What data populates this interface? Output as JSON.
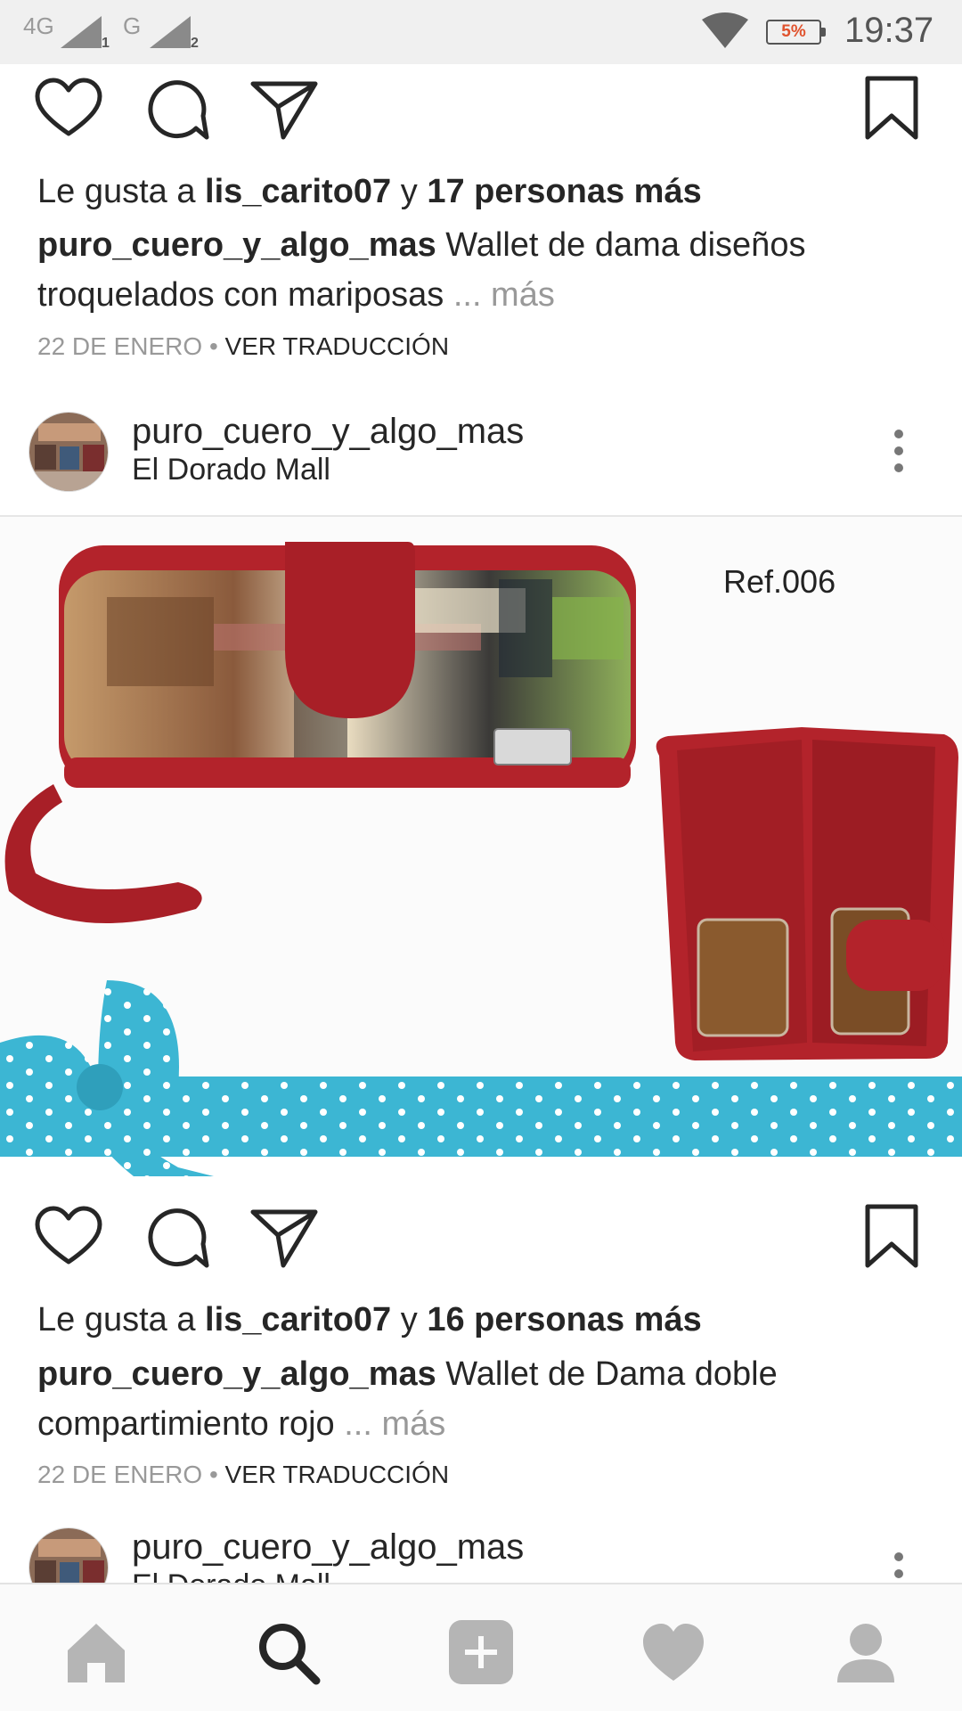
{
  "status_bar": {
    "signal1_label": "4G",
    "signal1_sub": "1",
    "signal2_label": "G",
    "signal2_sub": "2",
    "battery": "5%",
    "time": "19:37"
  },
  "post1_footer": {
    "likes_prefix": "Le gusta a ",
    "likes_user": "lis_carito07",
    "likes_mid": " y ",
    "likes_count": "17 personas más",
    "caption_user": "puro_cuero_y_algo_mas",
    "caption_text": " Wallet de dama diseños troquelados con mariposas ",
    "caption_more": "... más",
    "date": "22 DE ENERO",
    "separator": " • ",
    "translate": "VER TRADUCCIÓN"
  },
  "post2": {
    "username": "puro_cuero_y_algo_mas",
    "location": "El Dorado Mall",
    "image_ref": "Ref.006",
    "likes_prefix": "Le gusta a ",
    "likes_user": "lis_carito07",
    "likes_mid": " y ",
    "likes_count": "16 personas más",
    "caption_user": "puro_cuero_y_algo_mas",
    "caption_text": " Wallet de Dama doble compartimiento rojo ",
    "caption_more": "... más",
    "date": "22 DE ENERO",
    "separator": " • ",
    "translate": "VER TRADUCCIÓN"
  },
  "post3": {
    "username": "puro_cuero_y_algo_mas",
    "location": "El Dorado Mall"
  },
  "icons": {
    "like": "heart-outline",
    "comment": "speech-bubble",
    "share": "paper-plane",
    "save": "bookmark",
    "nav": [
      "home",
      "search",
      "add",
      "heart",
      "profile"
    ]
  },
  "colors": {
    "text": "#262626",
    "muted": "#999999",
    "wallet_red": "#b3232b",
    "ribbon": "#3cb6d3"
  }
}
